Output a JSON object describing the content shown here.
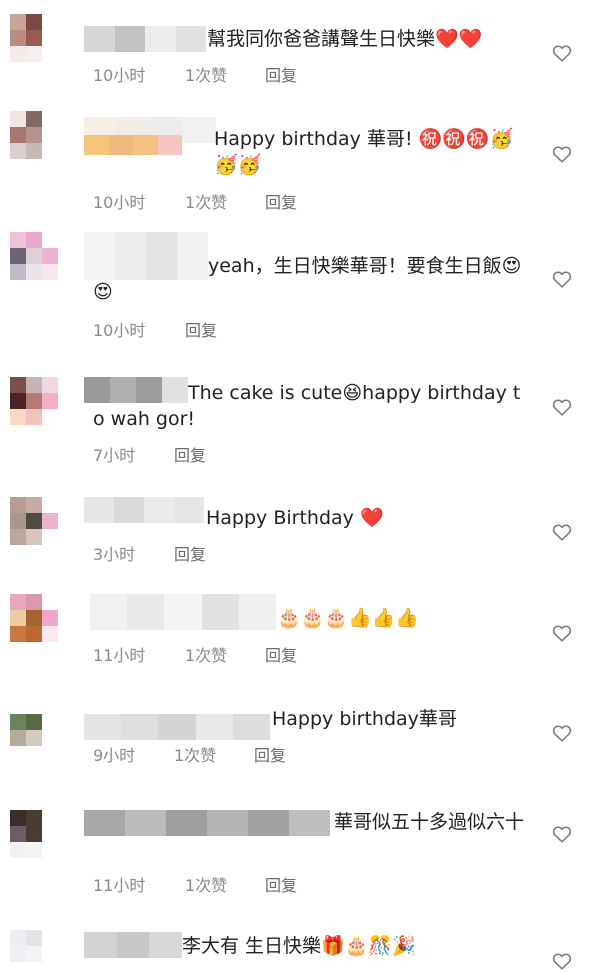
{
  "comments": [
    {
      "text": "幫我同你爸爸講聲生日快樂❤️❤️",
      "time": "10小时",
      "likes": "1次赞",
      "reply": "回复"
    },
    {
      "text": "Happy birthday 華哥! ㊗️㊗️㊗️🥳🥳🥳",
      "time": "10小时",
      "likes": "1次赞",
      "reply": "回复"
    },
    {
      "text": "yeah，生日快樂華哥！要食生日飯😍😍",
      "time": "10小时",
      "likes": "",
      "reply": "回复"
    },
    {
      "text": "The cake is cute😆happy birthday to wah gor!",
      "time": "7小时",
      "likes": "",
      "reply": "回复"
    },
    {
      "text": "Happy Birthday ❤️",
      "time": "3小时",
      "likes": "",
      "reply": "回复"
    },
    {
      "text": "🎂🎂🎂👍👍👍",
      "time": "11小时",
      "likes": "1次赞",
      "reply": "回复"
    },
    {
      "text": "Happy birthday華哥",
      "time": "9小时",
      "likes": "1次赞",
      "reply": "回复"
    },
    {
      "text": "華哥似五十多過似六十",
      "time": "11小时",
      "likes": "1次赞",
      "reply": "回复"
    },
    {
      "text": "李大有 生日快樂🎁🎂🎊🎉",
      "time": "",
      "likes": "",
      "reply": ""
    }
  ],
  "icons": {
    "like": "heart-outline-icon"
  }
}
